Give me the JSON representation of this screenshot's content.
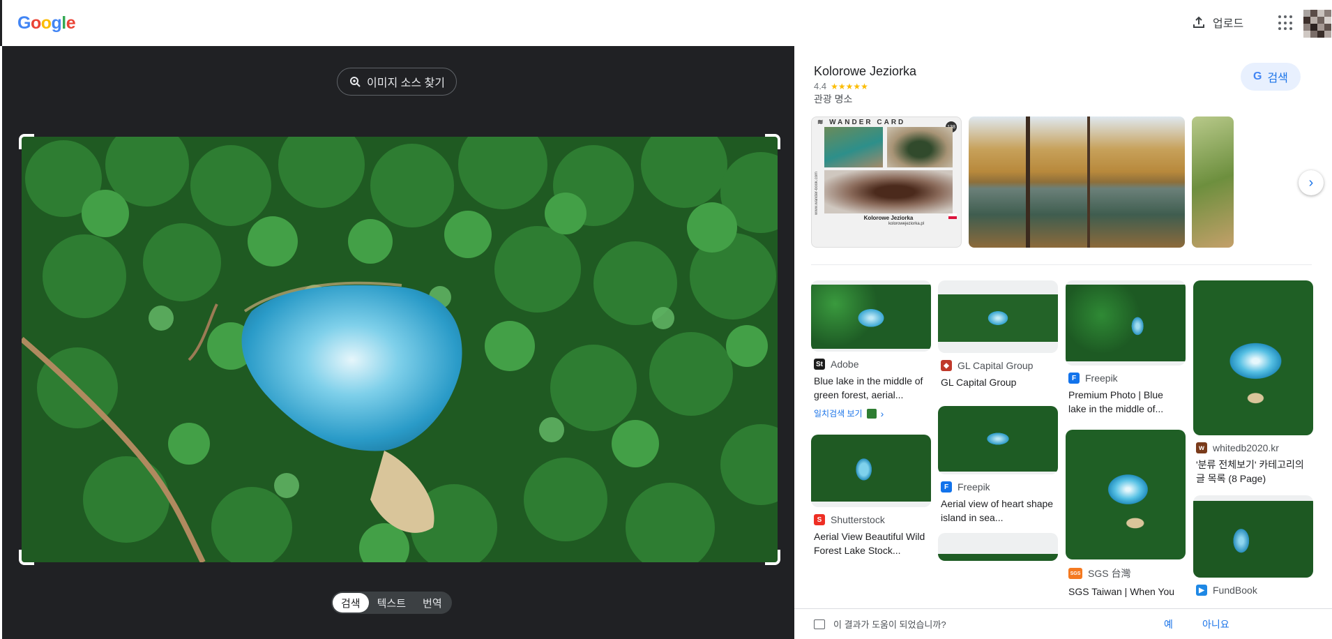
{
  "header": {
    "logo_letters": [
      {
        "ch": "G",
        "color": "#4285F4"
      },
      {
        "ch": "o",
        "color": "#EA4335"
      },
      {
        "ch": "o",
        "color": "#FBBC05"
      },
      {
        "ch": "g",
        "color": "#4285F4"
      },
      {
        "ch": "l",
        "color": "#34A853"
      },
      {
        "ch": "e",
        "color": "#EA4335"
      }
    ],
    "upload_label": "업로드",
    "apps_icon": "apps-grid-icon",
    "avatar_icon": "account-avatar"
  },
  "lens": {
    "find_source_label": "이미지 소스 찾기",
    "modes": [
      "검색",
      "텍스트",
      "번역"
    ],
    "active_mode": "검색"
  },
  "knowledge_panel": {
    "title": "Kolorowe Jeziorka",
    "rating": "4.4",
    "stars": "★★★★★",
    "subtitle": "관광 명소",
    "search_button": "검색",
    "search_button_g": "G",
    "postcard": {
      "brand": "WANDER CARD",
      "number": "138",
      "caption": "Kolorowe Jeziorka",
      "site": "kolorowejeziorka.pl",
      "side_url": "www.wander-book.com"
    }
  },
  "results": {
    "col1": [
      {
        "source": "Adobe",
        "favicon": "St",
        "fav_color": "#1c1c1c",
        "title": "Blue lake in the middle of green forest, aerial...",
        "match_label": "일치검색 보기"
      },
      {
        "source": "Shutterstock",
        "favicon": "S",
        "fav_color": "#ee2e24",
        "title": "Aerial View Beautiful Wild Forest Lake Stock..."
      }
    ],
    "col2": [
      {
        "source": "GL Capital Group",
        "favicon": "◆",
        "fav_color": "#c0392b",
        "title": "GL Capital Group"
      },
      {
        "source": "Freepik",
        "favicon": "F",
        "fav_color": "#1273eb",
        "title": "Aerial view of heart shape island in sea..."
      }
    ],
    "col3": [
      {
        "source": "Freepik",
        "favicon": "F",
        "fav_color": "#1273eb",
        "title": "Premium Photo | Blue lake in the middle of..."
      },
      {
        "source": "SGS 台灣",
        "favicon": "SGS",
        "fav_color": "#f47920",
        "title": "SGS Taiwan | When You"
      }
    ],
    "col4": [
      {
        "source": "whitedb2020.kr",
        "favicon": "w",
        "fav_color": "#7a3b1b",
        "title": "'분류 전체보기' 카테고리의 글 목록 (8 Page)"
      },
      {
        "source": "FundBook",
        "favicon": "▶",
        "fav_color": "#1e88e5",
        "title": ""
      }
    ]
  },
  "feedback": {
    "question": "이 결과가 도움이 되었습니까?",
    "yes": "예",
    "no": "아니요"
  },
  "colors": {
    "dark_bg": "#202124",
    "accent": "#1a73e8",
    "chip_bg": "#e8f0fe"
  }
}
